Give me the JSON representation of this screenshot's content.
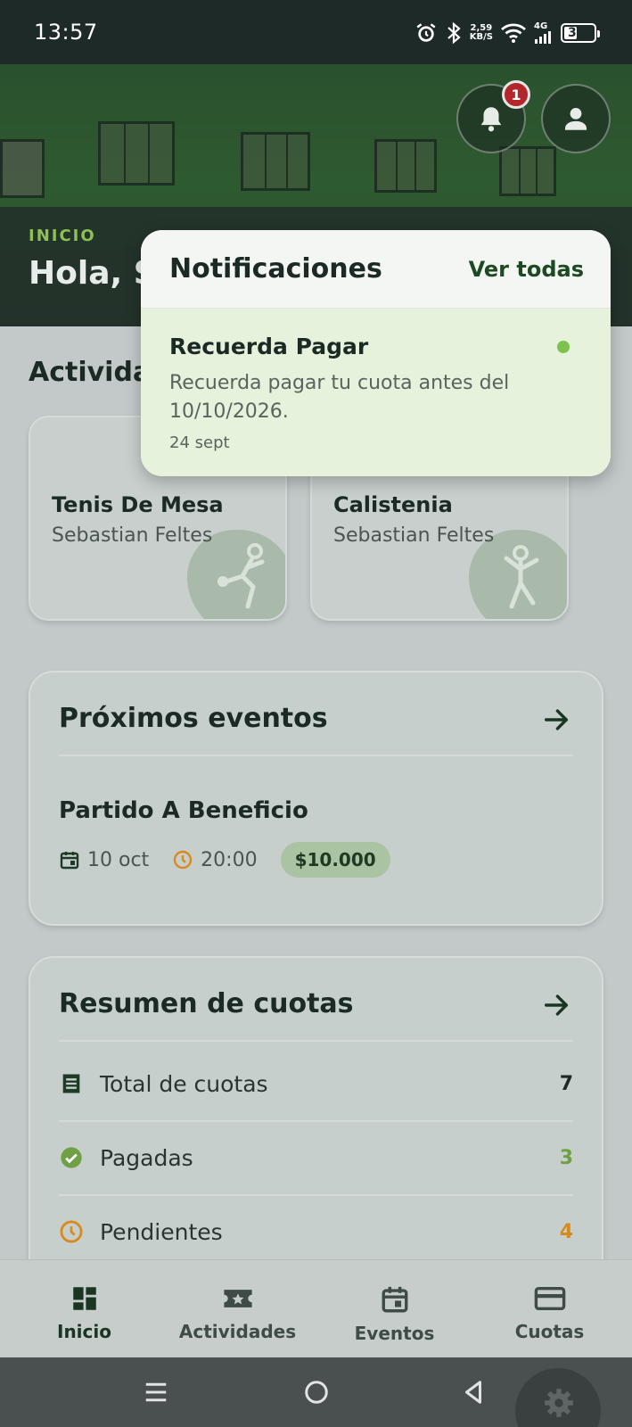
{
  "status_bar": {
    "time": "13:57",
    "speed_value": "2,59",
    "speed_unit": "KB/S",
    "network": "4G",
    "battery": "39"
  },
  "header": {
    "kicker": "INICIO",
    "greeting": "Hola, S",
    "notification_count": "1"
  },
  "activities": {
    "title": "Activida",
    "items": [
      {
        "name": "Tenis De Mesa",
        "instructor": "Sebastian Feltes"
      },
      {
        "name": "Calistenia",
        "instructor": "Sebastian Feltes"
      }
    ]
  },
  "events": {
    "title": "Próximos eventos",
    "item": {
      "name": "Partido A Beneficio",
      "date": "10 oct",
      "time": "20:00",
      "price": "$10.000"
    }
  },
  "fees": {
    "title": "Resumen de cuotas",
    "rows": [
      {
        "label": "Total de cuotas",
        "value": "7",
        "color": "#1c2a25"
      },
      {
        "label": "Pagadas",
        "value": "3",
        "color": "#6fa046"
      },
      {
        "label": "Pendientes",
        "value": "4",
        "color": "#d98a1c"
      }
    ]
  },
  "notifications": {
    "title": "Notificaciones",
    "view_all": "Ver todas",
    "item": {
      "title": "Recuerda Pagar",
      "body": "Recuerda pagar tu cuota antes del 10/10/2026.",
      "date": "24 sept"
    }
  },
  "bottom_nav": [
    {
      "label": "Inicio",
      "icon": "dashboard-icon",
      "active": true
    },
    {
      "label": "Actividades",
      "icon": "star-ticket-icon",
      "active": false
    },
    {
      "label": "Eventos",
      "icon": "calendar-icon",
      "active": false
    },
    {
      "label": "Cuotas",
      "icon": "credit-card-icon",
      "active": false
    }
  ],
  "colors": {
    "brand_dark": "#193622",
    "accent_green": "#7dc24d",
    "badge_red": "#b3262b",
    "pending_orange": "#d98a1c"
  }
}
